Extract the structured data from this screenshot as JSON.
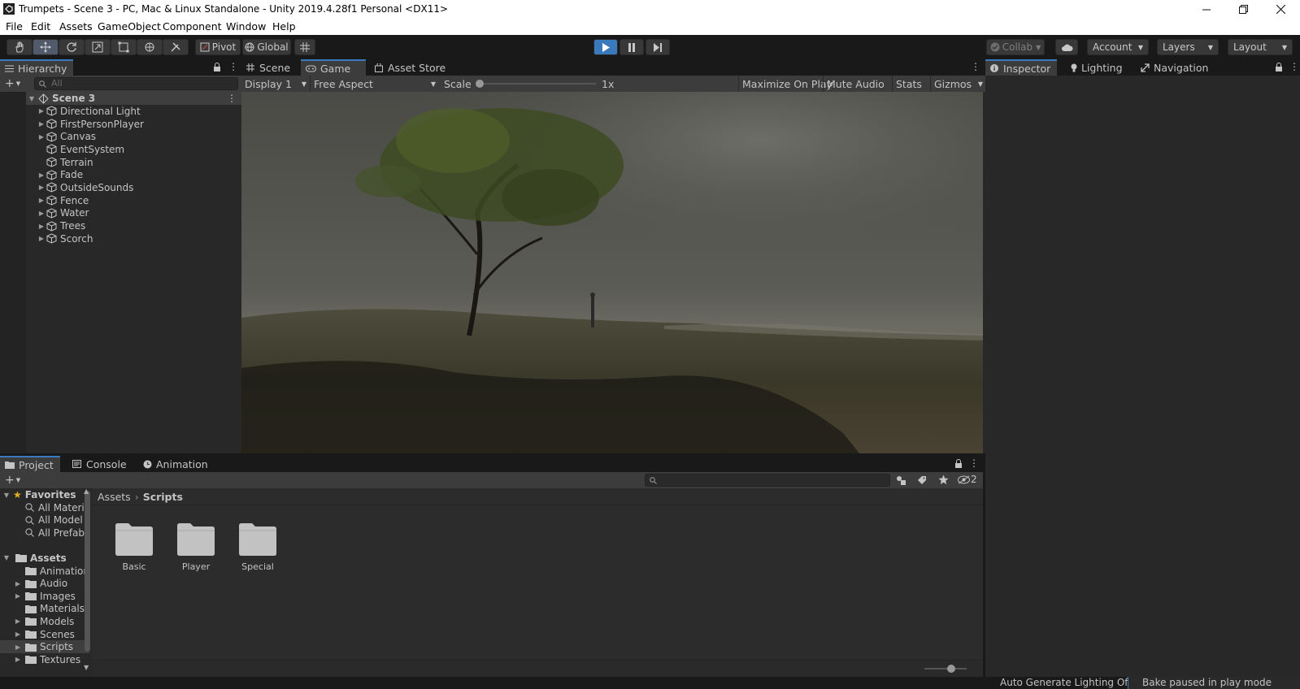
{
  "window": {
    "title": "Trumpets - Scene 3 - PC, Mac & Linux Standalone - Unity 2019.4.28f1 Personal <DX11>"
  },
  "menu": [
    "File",
    "Edit",
    "Assets",
    "GameObject",
    "Component",
    "Window",
    "Help"
  ],
  "toolbar": {
    "pivot_label": "Pivot",
    "global_label": "Global",
    "collab_label": "Collab",
    "account_label": "Account",
    "layers_label": "Layers",
    "layout_label": "Layout"
  },
  "hierarchy": {
    "tab_label": "Hierarchy",
    "search_placeholder": "All",
    "scene_name": "Scene 3",
    "items": [
      {
        "label": "Directional Light",
        "expandable": true
      },
      {
        "label": "FirstPersonPlayer",
        "expandable": true
      },
      {
        "label": "Canvas",
        "expandable": true
      },
      {
        "label": "EventSystem",
        "expandable": false
      },
      {
        "label": "Terrain",
        "expandable": false
      },
      {
        "label": "Fade",
        "expandable": true
      },
      {
        "label": "OutsideSounds",
        "expandable": true
      },
      {
        "label": "Fence",
        "expandable": true
      },
      {
        "label": "Water",
        "expandable": true
      },
      {
        "label": "Trees",
        "expandable": true
      },
      {
        "label": "Scorch",
        "expandable": true
      }
    ]
  },
  "center": {
    "tabs": [
      "Scene",
      "Game",
      "Asset Store"
    ],
    "selected_tab": "Game",
    "display_label": "Display 1",
    "aspect_label": "Free Aspect",
    "scale_label": "Scale",
    "scale_value": "1x",
    "maximize_label": "Maximize On Play",
    "mute_label": "Mute Audio",
    "stats_label": "Stats",
    "gizmos_label": "Gizmos"
  },
  "inspector": {
    "tabs": [
      "Inspector",
      "Lighting",
      "Navigation"
    ]
  },
  "project": {
    "tabs": [
      "Project",
      "Console",
      "Animation"
    ],
    "hidden_count": "2",
    "breadcrumb": [
      "Assets",
      "Scripts"
    ],
    "favorites_label": "Favorites",
    "favorites": [
      "All Materi",
      "All Model",
      "All Prefab"
    ],
    "assets_label": "Assets",
    "asset_folders": [
      {
        "label": "Animation",
        "expandable": false
      },
      {
        "label": "Audio",
        "expandable": true
      },
      {
        "label": "Images",
        "expandable": true
      },
      {
        "label": "Materials",
        "expandable": false
      },
      {
        "label": "Models",
        "expandable": true
      },
      {
        "label": "Scenes",
        "expandable": true
      },
      {
        "label": "Scripts",
        "expandable": true
      },
      {
        "label": "Textures",
        "expandable": true
      }
    ],
    "grid_folders": [
      "Basic",
      "Player",
      "Special"
    ]
  },
  "status": {
    "lighting": "Auto Generate Lighting Off",
    "bake": "Bake paused in play mode"
  },
  "colors": {
    "accent": "#3a79bb",
    "play_active": "#3a79bb"
  }
}
